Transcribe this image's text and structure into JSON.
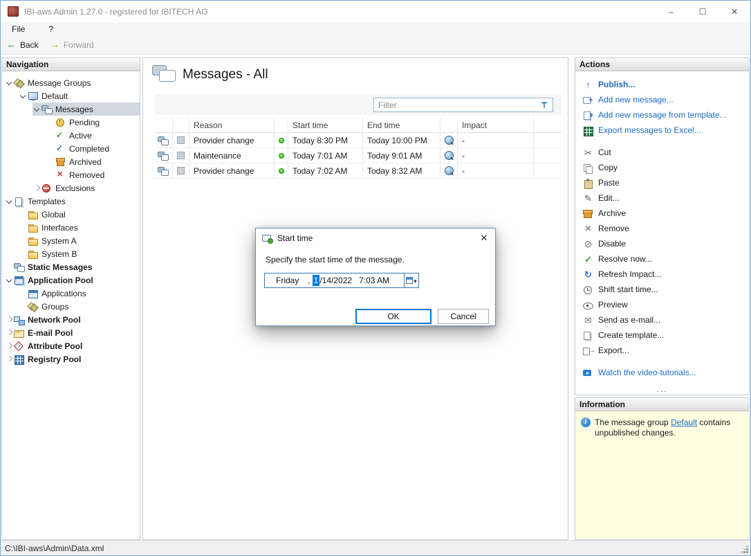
{
  "colors": {
    "accent": "#0078d7",
    "link_blue": "#1c6bc4",
    "info_bg": "#ffffe1",
    "status_green": "#35b51e",
    "selection": "#d2d8df"
  },
  "window": {
    "title": "IBI-aws Admin 1.27.0 - registered for IBITECH AG",
    "controls": {
      "minimize": "–",
      "maximize": "☐",
      "close": "✕"
    }
  },
  "menubar": {
    "items": [
      {
        "label": "File",
        "key": "file"
      },
      {
        "label": "?",
        "key": "help"
      }
    ]
  },
  "toolbar": {
    "back": "Back",
    "forward": "Forward"
  },
  "navigation": {
    "header": "Navigation",
    "items": [
      {
        "label": "Message Groups",
        "level": 0,
        "chevron": "down",
        "icon": "stack"
      },
      {
        "label": "Default",
        "level": 1,
        "chevron": "down",
        "icon": "monitor"
      },
      {
        "label": "Messages",
        "level": 2,
        "chevron": "down",
        "icon": "bubbles",
        "selected": true
      },
      {
        "label": "Pending",
        "level": 3,
        "icon": "pending"
      },
      {
        "label": "Active",
        "level": 3,
        "icon": "active"
      },
      {
        "label": "Completed",
        "level": 3,
        "icon": "completed"
      },
      {
        "label": "Archived",
        "level": 3,
        "icon": "archived"
      },
      {
        "label": "Removed",
        "level": 3,
        "icon": "removed"
      },
      {
        "label": "Exclusions",
        "level": 2,
        "chevron": "right",
        "icon": "exclusion"
      },
      {
        "label": "Templates",
        "level": 0,
        "chevron": "down",
        "icon": "templates"
      },
      {
        "label": "Global",
        "level": 1,
        "icon": "folder"
      },
      {
        "label": "Interfaces",
        "level": 1,
        "icon": "folder"
      },
      {
        "label": "System A",
        "level": 1,
        "icon": "folder"
      },
      {
        "label": "System B",
        "level": 1,
        "icon": "folder"
      },
      {
        "label": "Static Messages",
        "level": 0,
        "icon": "bubbles",
        "bold": true
      },
      {
        "label": "Application Pool",
        "level": 0,
        "chevron": "down",
        "icon": "apppool",
        "bold": true
      },
      {
        "label": "Applications",
        "level": 1,
        "icon": "applications"
      },
      {
        "label": "Groups",
        "level": 1,
        "icon": "stack"
      },
      {
        "label": "Network Pool",
        "level": 0,
        "chevron": "right",
        "icon": "network",
        "bold": true
      },
      {
        "label": "E-mail Pool",
        "level": 0,
        "chevron": "right",
        "icon": "email",
        "bold": true
      },
      {
        "label": "Attribute Pool",
        "level": 0,
        "chevron": "right",
        "icon": "attribute",
        "bold": true
      },
      {
        "label": "Registry Pool",
        "level": 0,
        "chevron": "right",
        "icon": "registry",
        "bold": true
      }
    ]
  },
  "content": {
    "title": "Messages - All",
    "filter_placeholder": "Filter",
    "table": {
      "columns": [
        "",
        "",
        "Reason",
        "",
        "Start time",
        "End time",
        "",
        "Impact"
      ],
      "rows": [
        {
          "reason": "Provider change",
          "start": "Today 8:30 PM",
          "end": "Today 10:00 PM",
          "impact": "-"
        },
        {
          "reason": "Maintenance",
          "start": "Today 7:01 AM",
          "end": "Today 9:01 AM",
          "impact": "-"
        },
        {
          "reason": "Provider change",
          "start": "Today 7:02 AM",
          "end": "Today 8:32 AM",
          "impact": "-"
        }
      ]
    }
  },
  "dialog": {
    "title": "Start time",
    "close": "✕",
    "message": "Specify the start time of the message.",
    "datetime": {
      "day": "Friday",
      "separator": ", ",
      "highlight": "1",
      "rest": "/14/2022",
      "time": "7:03 AM"
    },
    "ok": "OK",
    "cancel": "Cancel"
  },
  "actions": {
    "header": "Actions",
    "overflow": "...",
    "items": [
      {
        "label": "Publish...",
        "type": "link",
        "icon": "publish",
        "bold": true
      },
      {
        "label": "Add new message...",
        "type": "link",
        "icon": "add-message"
      },
      {
        "label": "Add new message from template...",
        "type": "link",
        "icon": "add-template"
      },
      {
        "label": "Export messages to Excel...",
        "type": "link",
        "icon": "excel",
        "gap_after": true
      },
      {
        "label": "Cut",
        "icon": "cut"
      },
      {
        "label": "Copy",
        "icon": "copy"
      },
      {
        "label": "Paste",
        "icon": "paste"
      },
      {
        "label": "Edit...",
        "icon": "edit"
      },
      {
        "label": "Archive",
        "icon": "archive"
      },
      {
        "label": "Remove",
        "icon": "remove"
      },
      {
        "label": "Disable",
        "icon": "disable"
      },
      {
        "label": "Resolve now...",
        "icon": "resolve"
      },
      {
        "label": "Refresh Impact...",
        "icon": "refresh"
      },
      {
        "label": "Shift start time...",
        "icon": "clock"
      },
      {
        "label": "Preview",
        "icon": "preview"
      },
      {
        "label": "Send as e-mail...",
        "icon": "send-email"
      },
      {
        "label": "Create template...",
        "icon": "create-template"
      },
      {
        "label": "Export...",
        "icon": "export",
        "gap_after": true
      },
      {
        "label": "Watch the video-tutorials...",
        "type": "link",
        "icon": "video"
      }
    ]
  },
  "information": {
    "header": "Information",
    "text_before": "The message group ",
    "link": "Default",
    "text_after": " contains unpublished changes."
  },
  "statusbar": {
    "path": "C:\\IBI-aws\\Admin\\Data.xml"
  }
}
